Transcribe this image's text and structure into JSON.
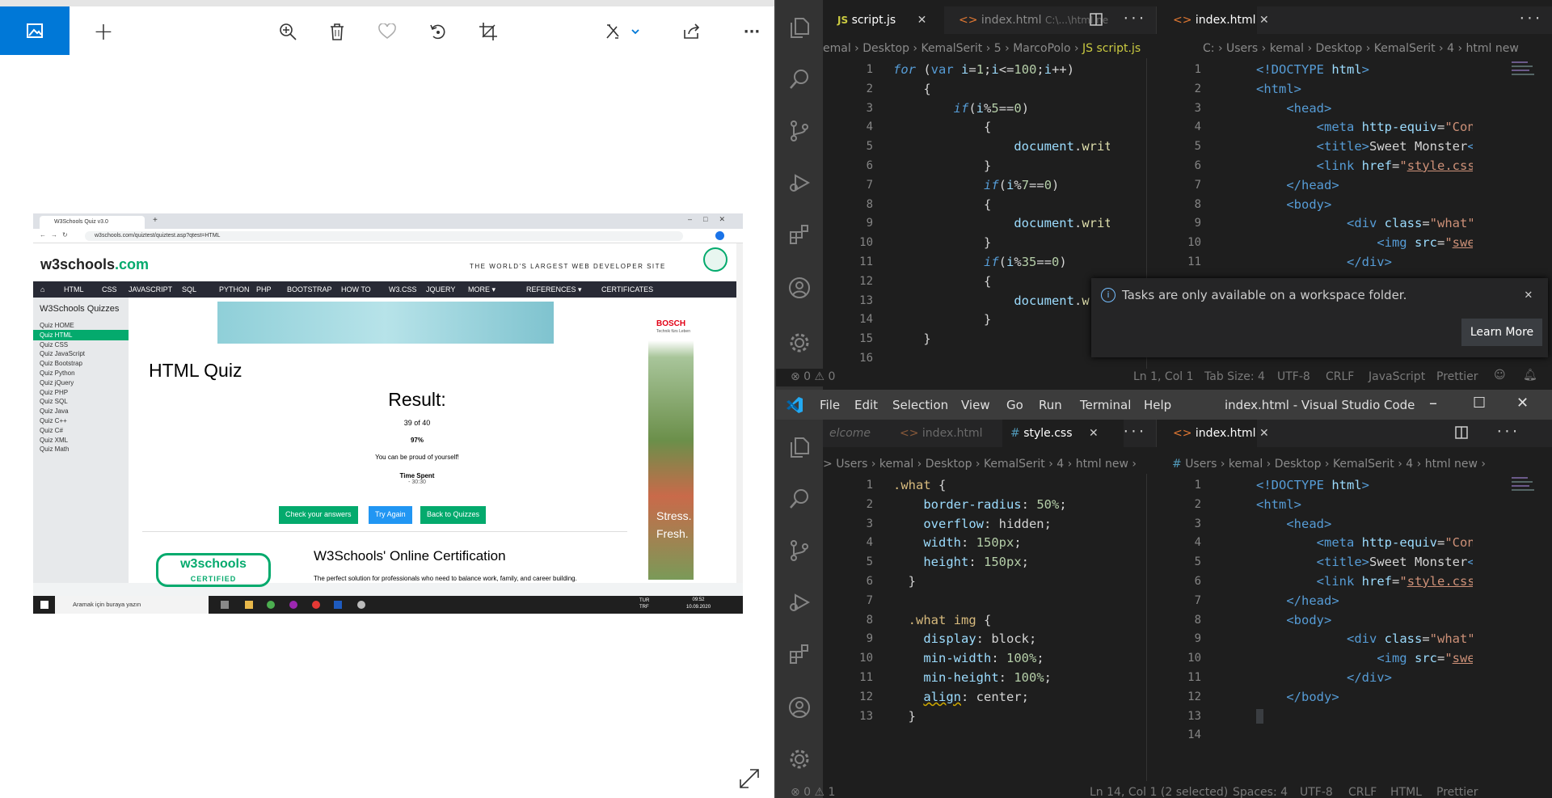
{
  "photos": {
    "toolbar": {
      "add": "+",
      "zoom_in": "zoom-in-icon",
      "delete": "trash-icon",
      "favorite": "heart-icon",
      "rotate": "rotate-icon",
      "crop": "crop-icon",
      "edit": "edit-draw-icon",
      "share": "share-icon",
      "more": "···"
    },
    "screenshot": {
      "tab_title": "W3Schools Quiz v3.0",
      "url": "w3schools.com/quiztest/quiztest.asp?qtest=HTML",
      "logo_main": "w3schools",
      "logo_com": ".com",
      "tagline": "THE WORLD'S LARGEST WEB DEVELOPER SITE",
      "nav": [
        "HTML",
        "CSS",
        "JAVASCRIPT",
        "SQL",
        "PYTHON",
        "PHP",
        "BOOTSTRAP",
        "HOW TO",
        "W3.CSS",
        "JQUERY",
        "MORE ▾",
        "REFERENCES ▾",
        "CERTIFICATES"
      ],
      "sidebar_title": "W3Schools Quizzes",
      "sidebar_items": [
        "Quiz HOME",
        "Quiz HTML",
        "Quiz CSS",
        "Quiz JavaScript",
        "Quiz Bootstrap",
        "Quiz Python",
        "Quiz jQuery",
        "Quiz PHP",
        "Quiz SQL",
        "Quiz Java",
        "Quiz C++",
        "Quiz C#",
        "Quiz XML",
        "Quiz Math"
      ],
      "heading": "HTML Quiz",
      "result_label": "Result:",
      "score": "39 of 40",
      "percent": "97%",
      "message": "You can be proud of yourself!",
      "time_label": "Time Spent",
      "time_value": "- 30:30",
      "btn_check": "Check your answers",
      "btn_try": "Try Again",
      "btn_back": "Back to Quizzes",
      "cert_title": "W3Schools' Online Certification",
      "cert_text": "The perfect solution for professionals who need to balance work, family, and career building.",
      "cert_logo": "w3schools",
      "cert_logo_sub": "CERTIFIED",
      "ad_brand": "BOSCH",
      "ad_sub": "Technik fürs Leben",
      "ad_text": "Stress. Fresh.",
      "taskbar_search": "Aramak için buraya yazın",
      "tray_lang": "TUR TRF",
      "clock_time": "09:52",
      "clock_date": "10.09.2020"
    }
  },
  "vscode_top": {
    "tabs": [
      "script.js",
      "index.html",
      "C:\\...\\html ne",
      "index.html"
    ],
    "tab_badge_js": "JS",
    "breadcrumb_left": "emal › Desktop › KemalSerit › 5 › MarcoPolo › ",
    "breadcrumb_file": "JS script.js",
    "breadcrumb_right": "C: › Users › kemal › Desktop › KemalSerit › 4 › html new",
    "left_lines": [
      "1",
      "2",
      "3",
      "4",
      "5",
      "6",
      "7",
      "8",
      "9",
      "10",
      "11",
      "12",
      "13",
      "14",
      "15",
      "16"
    ],
    "right_lines": [
      "1",
      "2",
      "3",
      "4",
      "5",
      "6",
      "7",
      "8",
      "9",
      "10",
      "11"
    ],
    "notification": "Tasks are only available on a workspace folder.",
    "learn_more": "Learn More",
    "status": {
      "problems": "⊗ 0 ⚠ 0",
      "position": "Ln 1, Col 1",
      "tab_size": "Tab Size: 4",
      "encoding": "UTF-8",
      "eol": "CRLF",
      "language": "JavaScript",
      "formatter": "Prettier"
    }
  },
  "vscode_bottom": {
    "menu": [
      "File",
      "Edit",
      "Selection",
      "View",
      "Go",
      "Run",
      "Terminal",
      "Help"
    ],
    "window_title": "index.html - Visual Studio Code",
    "tabs": [
      "elcome",
      "index.html",
      "style.css",
      "index.html"
    ],
    "breadcrumb_left": "Users › kemal › Desktop › KemalSerit › 4 › html new ›",
    "breadcrumb_right": "Users › kemal › Desktop › KemalSerit › 4 › html new ›",
    "left_lines": [
      "1",
      "2",
      "3",
      "4",
      "5",
      "6",
      "7",
      "8",
      "9",
      "10",
      "11",
      "12",
      "13"
    ],
    "right_lines": [
      "1",
      "2",
      "3",
      "4",
      "5",
      "6",
      "7",
      "8",
      "9",
      "10",
      "11",
      "12",
      "13",
      "14"
    ],
    "status": {
      "problems": "⊗ 0 ⚠ 1",
      "position": "Ln 14, Col 1 (2 selected)",
      "spaces": "Spaces: 4",
      "encoding": "UTF-8",
      "eol": "CRLF",
      "language": "HTML",
      "formatter": "Prettier"
    }
  },
  "colors": {
    "accent": "#0078d7",
    "vscode_bg": "#1e1e1e",
    "w3_green": "#04aa6d"
  }
}
